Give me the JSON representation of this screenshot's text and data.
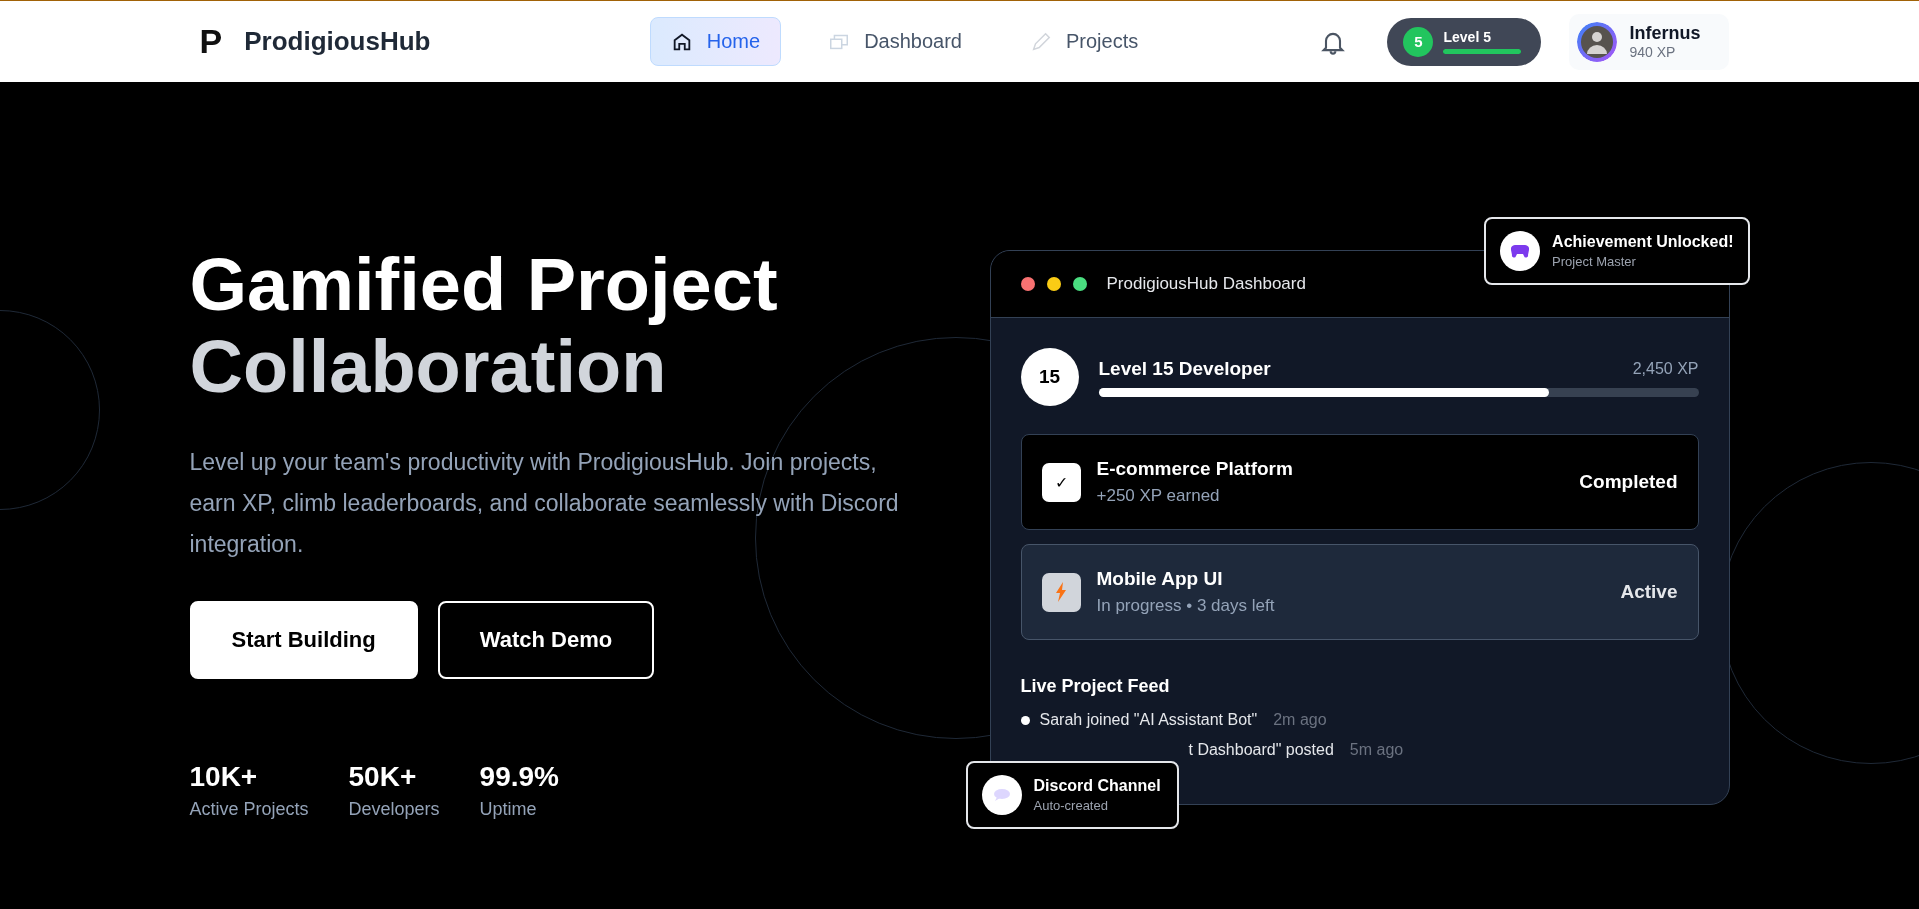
{
  "nav": {
    "logo_mark": "P",
    "brand": "ProdigiousHub",
    "tabs": [
      {
        "label": "Home",
        "kind": "home",
        "selected": true
      },
      {
        "label": "Dashboard",
        "kind": "dashboard",
        "selected": false
      },
      {
        "label": "Projects",
        "kind": "projects",
        "selected": false
      }
    ],
    "level_badge": {
      "number": "5",
      "label": "Level 5",
      "level": 1
    },
    "user": {
      "name": "Infernus",
      "xp": "940 XP"
    }
  },
  "hero": {
    "title_lines": [
      "Gamified Project",
      "Collaboration"
    ],
    "description": "Level up your team's productivity with ProdigiousHub. Join projects, earn XP, climb leaderboards, and collaborate seamlessly with Discord integration.",
    "buttons": [
      {
        "label": "Start Building",
        "kind": "primary"
      },
      {
        "label": "Watch Demo",
        "kind": "outline"
      }
    ],
    "stats": [
      {
        "value": "10K+",
        "label": "Active Projects"
      },
      {
        "value": "50K+",
        "label": "Developers"
      },
      {
        "value": "99.9%",
        "label": "Uptime"
      }
    ]
  },
  "dashboard": {
    "title": "ProdigiousHub Dashboard",
    "level": {
      "badge": "15",
      "title": "Level 15 Developer",
      "xp": "2,450 XP",
      "level": 0.75
    },
    "projects": [
      {
        "name": "E-commerce Platform",
        "detail": "+250 XP earned",
        "status": "Completed",
        "kind": "completed",
        "icon": "✓"
      },
      {
        "name": "Mobile App UI",
        "detail": "In progress • 3 days left",
        "status": "Active",
        "kind": "active"
      }
    ],
    "feed_title": "Live Project Feed",
    "feed": [
      {
        "text": "Sarah joined \"AI Assistant Bot\"",
        "time": "2m ago",
        "covered": false
      },
      {
        "text": "t Dashboard\" posted",
        "time": "5m ago",
        "covered": true
      }
    ]
  },
  "toasts": [
    {
      "title": "Achievement Unlocked!",
      "subtitle": "Project Master",
      "kind": "achievement"
    },
    {
      "title": "Discord Channel",
      "subtitle": "Auto-created",
      "kind": "discord"
    }
  ]
}
